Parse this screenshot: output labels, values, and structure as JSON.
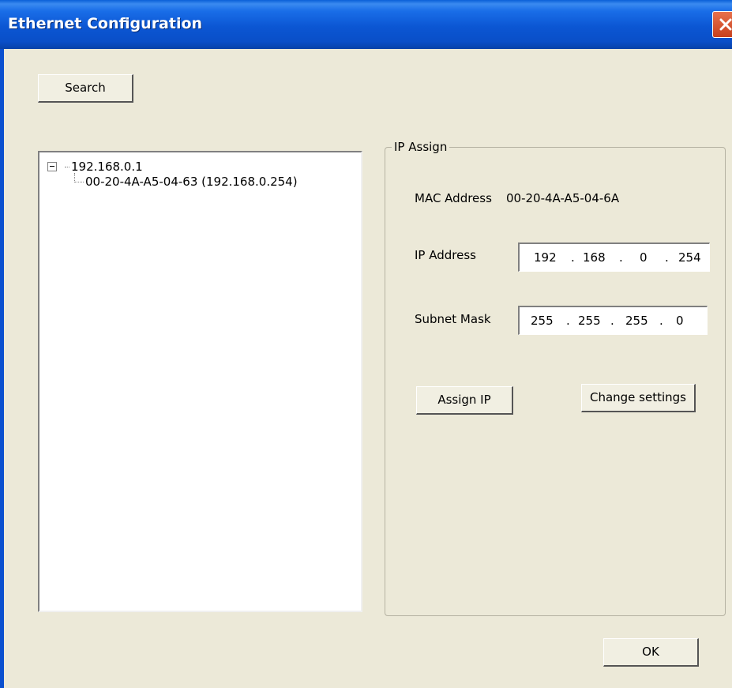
{
  "window": {
    "title": "Ethernet Configuration"
  },
  "toolbar": {
    "search_label": "Search"
  },
  "tree": {
    "root": "192.168.0.1",
    "child": "00-20-4A-A5-04-63 (192.168.0.254)"
  },
  "ip_assign": {
    "group_label": "IP Assign",
    "mac_label": "MAC Address",
    "mac_value": "00-20-4A-A5-04-6A",
    "ip_label": "IP Address",
    "ip_octets": [
      "192",
      "168",
      "0",
      "254"
    ],
    "subnet_label": "Subnet Mask",
    "subnet_octets": [
      "255",
      "255",
      "255",
      "0"
    ],
    "dot": ".",
    "assign_label": "Assign IP",
    "change_label": "Change settings"
  },
  "footer": {
    "ok_label": "OK"
  },
  "colors": {
    "titlebar": "#0a55d4",
    "face": "#ece9d8",
    "close": "#d9532f"
  }
}
